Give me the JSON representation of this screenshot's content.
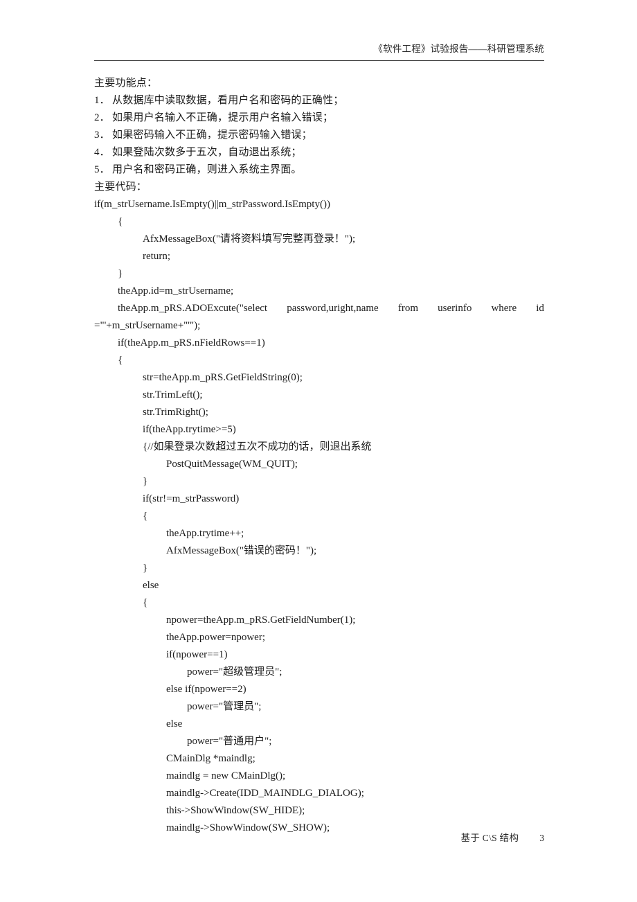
{
  "header": {
    "text": "《软件工程》试验报告——科研管理系统"
  },
  "sections": {
    "features_heading": "主要功能点：",
    "features": [
      {
        "num": "1．",
        "text": "从数据库中读取数据，看用户名和密码的正确性；"
      },
      {
        "num": "2．",
        "text": "如果用户名输入不正确，提示用户名输入错误；"
      },
      {
        "num": "3．",
        "text": "如果密码输入不正确，提示密码输入错误；"
      },
      {
        "num": "4．",
        "text": "如果登陆次数多于五次，自动退出系统；"
      },
      {
        "num": "5．",
        "text": "用户名和密码正确，则进入系统主界面。"
      }
    ],
    "code_heading": "主要代码："
  },
  "code_lines": [
    {
      "indent": 0,
      "text": "if(m_strUsername.IsEmpty()||m_strPassword.IsEmpty())"
    },
    {
      "indent": 1,
      "text": "{"
    },
    {
      "indent": 2,
      "text": "AfxMessageBox(\"请将资料填写完整再登录！\");"
    },
    {
      "indent": 2,
      "text": "return;"
    },
    {
      "indent": 1,
      "text": "}"
    },
    {
      "indent": 1,
      "text": "theApp.id=m_strUsername;"
    }
  ],
  "justified_line": {
    "words": [
      "theApp.m_pRS.ADOExcute(\"select",
      "password,uright,name",
      "from",
      "userinfo",
      "where",
      "id"
    ]
  },
  "code_lines_2": [
    {
      "indent": 0,
      "text": "=\"'+m_strUsername+\"'\");"
    },
    {
      "indent": 1,
      "text": "if(theApp.m_pRS.nFieldRows==1)"
    },
    {
      "indent": 1,
      "text": "{"
    },
    {
      "indent": 2,
      "text": "str=theApp.m_pRS.GetFieldString(0);"
    },
    {
      "indent": 2,
      "text": "str.TrimLeft();"
    },
    {
      "indent": 2,
      "text": "str.TrimRight();"
    },
    {
      "indent": 2,
      "text": "if(theApp.trytime>=5)"
    },
    {
      "indent": 2,
      "text": "{//如果登录次数超过五次不成功的话，则退出系统"
    },
    {
      "indent": 3,
      "text": "PostQuitMessage(WM_QUIT);"
    },
    {
      "indent": 2,
      "text": "}"
    },
    {
      "indent": 2,
      "text": "if(str!=m_strPassword)"
    },
    {
      "indent": 2,
      "text": "{"
    },
    {
      "indent": 3,
      "text": "theApp.trytime++;"
    },
    {
      "indent": 3,
      "text": "AfxMessageBox(\"错误的密码！\");"
    },
    {
      "indent": 2,
      "text": "}"
    },
    {
      "indent": 2,
      "text": "else"
    },
    {
      "indent": 2,
      "text": "{"
    },
    {
      "indent": 3,
      "text": "npower=theApp.m_pRS.GetFieldNumber(1);"
    },
    {
      "indent": 3,
      "text": "theApp.power=npower;"
    },
    {
      "indent": 3,
      "text": "if(npower==1)"
    },
    {
      "indent": 4,
      "text": "power=\"超级管理员\";"
    },
    {
      "indent": 3,
      "text": "else if(npower==2)"
    },
    {
      "indent": 4,
      "text": "power=\"管理员\";"
    },
    {
      "indent": 3,
      "text": "else"
    },
    {
      "indent": 4,
      "text": "power=\"普通用户\";"
    },
    {
      "indent": 3,
      "text": "CMainDlg *maindlg;"
    },
    {
      "indent": 3,
      "text": "maindlg = new CMainDlg();"
    },
    {
      "indent": 3,
      "text": "maindlg->Create(IDD_MAINDLG_DIALOG);"
    },
    {
      "indent": 3,
      "text": "this->ShowWindow(SW_HIDE);"
    },
    {
      "indent": 3,
      "text": "maindlg->ShowWindow(SW_SHOW);"
    }
  ],
  "footer": {
    "label": "基于 C\\S 结构",
    "page": "3"
  }
}
